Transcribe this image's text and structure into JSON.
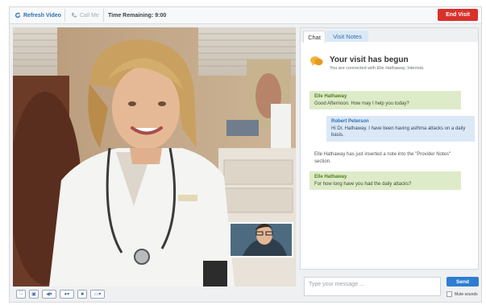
{
  "topbar": {
    "refresh_label": "Refresh Video",
    "callme_label": "Call Me",
    "time_remaining": "Time Remaining: 9:00",
    "end_visit_label": "End Visit"
  },
  "tabs": [
    {
      "label": "Chat",
      "active": true
    },
    {
      "label": "Visit Notes",
      "active": false
    }
  ],
  "visit": {
    "title": "Your visit has begun",
    "subtitle": "You are connected with Elle Hathaway, Internist."
  },
  "messages": [
    {
      "type": "provider",
      "sender": "Elle Hathaway",
      "text": "Good Afternoon. How may I help you today?"
    },
    {
      "type": "patient",
      "sender": "Robert Peterson",
      "text": "Hi Dr. Hathaway. I have been having asthma attacks on a daily basis."
    },
    {
      "type": "system",
      "sender": "",
      "text": "Elle Hathaway has just inserted a note into the \"Provider Notes\" section."
    },
    {
      "type": "provider",
      "sender": "Elle Hathaway",
      "text": "For how long have you had the daily attacks?"
    }
  ],
  "composer": {
    "placeholder": "Type your message ...",
    "send_label": "Send",
    "mute_label": "Mute sounds"
  },
  "video_toolbar": [
    "fullscreen-icon",
    "popout-icon",
    "speaker-icon",
    "microphone-icon",
    "camera-icon",
    "screen-share-icon"
  ],
  "colors": {
    "accent": "#2d7dd2",
    "end_visit": "#d9302b",
    "provider_bubble": "#deebc9",
    "patient_bubble": "#dbe8f6"
  }
}
